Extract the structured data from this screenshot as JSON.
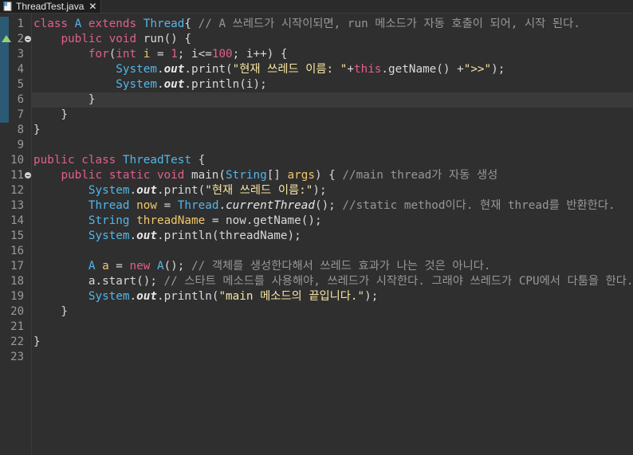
{
  "tab": {
    "title": "ThreadTest.java",
    "close": "✕"
  },
  "colors": {
    "keyword": "#e0608a",
    "type": "#53b6ea",
    "variable": "#f1c76c",
    "string": "#f6e3a2",
    "comment": "#979797",
    "field": "#e8e8e8",
    "plain": "#d8d8d8",
    "background": "#2f2f2f",
    "current_line": "#3a3a3a",
    "line_number": "#9a9a9a"
  },
  "gutter": {
    "line_numbers": [
      "1",
      "2",
      "3",
      "4",
      "5",
      "6",
      "7",
      "8",
      "9",
      "10",
      "11",
      "12",
      "13",
      "14",
      "15",
      "16",
      "17",
      "18",
      "19",
      "20",
      "21",
      "22",
      "23"
    ],
    "fold_lines": [
      2,
      11
    ],
    "warning_line": 2,
    "warning_icon": "override-triangle-icon",
    "fold_icon": "collapse-minus-icon"
  },
  "current_line": 6,
  "code_lines": [
    [
      [
        "kw",
        "class "
      ],
      [
        "type",
        "A "
      ],
      [
        "kw",
        "extends "
      ],
      [
        "type",
        "Thread"
      ],
      [
        "plain",
        "{ "
      ],
      [
        "cmt",
        "// A 쓰레드가 시작이되면, run 메소드가 자동 호출이 되어, 시작 된다."
      ]
    ],
    [
      [
        "plain",
        "    "
      ],
      [
        "kw",
        "public void "
      ],
      [
        "method",
        "run"
      ],
      [
        "plain",
        "() {"
      ]
    ],
    [
      [
        "plain",
        "        "
      ],
      [
        "kw",
        "for"
      ],
      [
        "plain",
        "("
      ],
      [
        "kw",
        "int "
      ],
      [
        "var",
        "i"
      ],
      [
        "plain",
        " = "
      ],
      [
        "kw",
        "1"
      ],
      [
        "plain",
        "; i<="
      ],
      [
        "kw",
        "100"
      ],
      [
        "plain",
        "; i++) {"
      ]
    ],
    [
      [
        "plain",
        "            "
      ],
      [
        "type",
        "System"
      ],
      [
        "plain",
        "."
      ],
      [
        "field",
        "out"
      ],
      [
        "plain",
        "."
      ],
      [
        "method",
        "print"
      ],
      [
        "plain",
        "("
      ],
      [
        "str",
        "\"현재 쓰레드 이름: \""
      ],
      [
        "plain",
        "+"
      ],
      [
        "kw",
        "this"
      ],
      [
        "plain",
        ".getName() +"
      ],
      [
        "str",
        "\">>\""
      ],
      [
        "plain",
        ");"
      ]
    ],
    [
      [
        "plain",
        "            "
      ],
      [
        "type",
        "System"
      ],
      [
        "plain",
        "."
      ],
      [
        "field",
        "out"
      ],
      [
        "plain",
        "."
      ],
      [
        "method",
        "println"
      ],
      [
        "plain",
        "(i);"
      ]
    ],
    [
      [
        "plain",
        "        }"
      ]
    ],
    [
      [
        "plain",
        "    }"
      ]
    ],
    [
      [
        "plain",
        "}"
      ]
    ],
    [
      [
        "plain",
        ""
      ]
    ],
    [
      [
        "kw",
        "public class "
      ],
      [
        "type",
        "ThreadTest "
      ],
      [
        "plain",
        "{"
      ]
    ],
    [
      [
        "plain",
        "    "
      ],
      [
        "kw",
        "public static void "
      ],
      [
        "method",
        "main"
      ],
      [
        "plain",
        "("
      ],
      [
        "type",
        "String"
      ],
      [
        "plain",
        "[] "
      ],
      [
        "var",
        "args"
      ],
      [
        "plain",
        ") { "
      ],
      [
        "cmt",
        "//main thread가 자동 생성"
      ]
    ],
    [
      [
        "plain",
        "        "
      ],
      [
        "type",
        "System"
      ],
      [
        "plain",
        "."
      ],
      [
        "field",
        "out"
      ],
      [
        "plain",
        "."
      ],
      [
        "method",
        "print"
      ],
      [
        "plain",
        "("
      ],
      [
        "str",
        "\"현재 쓰레드 이름:\""
      ],
      [
        "plain",
        ");"
      ]
    ],
    [
      [
        "plain",
        "        "
      ],
      [
        "type",
        "Thread "
      ],
      [
        "var",
        "now"
      ],
      [
        "plain",
        " = "
      ],
      [
        "type",
        "Thread"
      ],
      [
        "plain",
        "."
      ],
      [
        "static",
        "currentThread"
      ],
      [
        "plain",
        "(); "
      ],
      [
        "cmt",
        "//static method이다. 현재 thread를 반환한다."
      ]
    ],
    [
      [
        "plain",
        "        "
      ],
      [
        "type",
        "String "
      ],
      [
        "var",
        "threadName"
      ],
      [
        "plain",
        " = now.getName();"
      ]
    ],
    [
      [
        "plain",
        "        "
      ],
      [
        "type",
        "System"
      ],
      [
        "plain",
        "."
      ],
      [
        "field",
        "out"
      ],
      [
        "plain",
        "."
      ],
      [
        "method",
        "println"
      ],
      [
        "plain",
        "(threadName);"
      ]
    ],
    [
      [
        "plain",
        ""
      ]
    ],
    [
      [
        "plain",
        "        "
      ],
      [
        "type",
        "A "
      ],
      [
        "var",
        "a"
      ],
      [
        "plain",
        " = "
      ],
      [
        "kw",
        "new "
      ],
      [
        "type",
        "A"
      ],
      [
        "plain",
        "(); "
      ],
      [
        "cmt",
        "// 객체를 생성한다해서 쓰레드 효과가 나는 것은 아니다."
      ]
    ],
    [
      [
        "plain",
        "        a.start(); "
      ],
      [
        "cmt",
        "// 스타트 메소드를 사용해야, 쓰레드가 시작한다. 그래야 쓰레드가 CPU에서 다툼을 한다."
      ]
    ],
    [
      [
        "plain",
        "        "
      ],
      [
        "type",
        "System"
      ],
      [
        "plain",
        "."
      ],
      [
        "field",
        "out"
      ],
      [
        "plain",
        "."
      ],
      [
        "method",
        "println"
      ],
      [
        "plain",
        "("
      ],
      [
        "str",
        "\"main 메소드의 끝입니다.\""
      ],
      [
        "plain",
        ");"
      ]
    ],
    [
      [
        "plain",
        "    }"
      ]
    ],
    [
      [
        "plain",
        ""
      ]
    ],
    [
      [
        "plain",
        "}"
      ]
    ],
    [
      [
        "plain",
        ""
      ]
    ]
  ]
}
